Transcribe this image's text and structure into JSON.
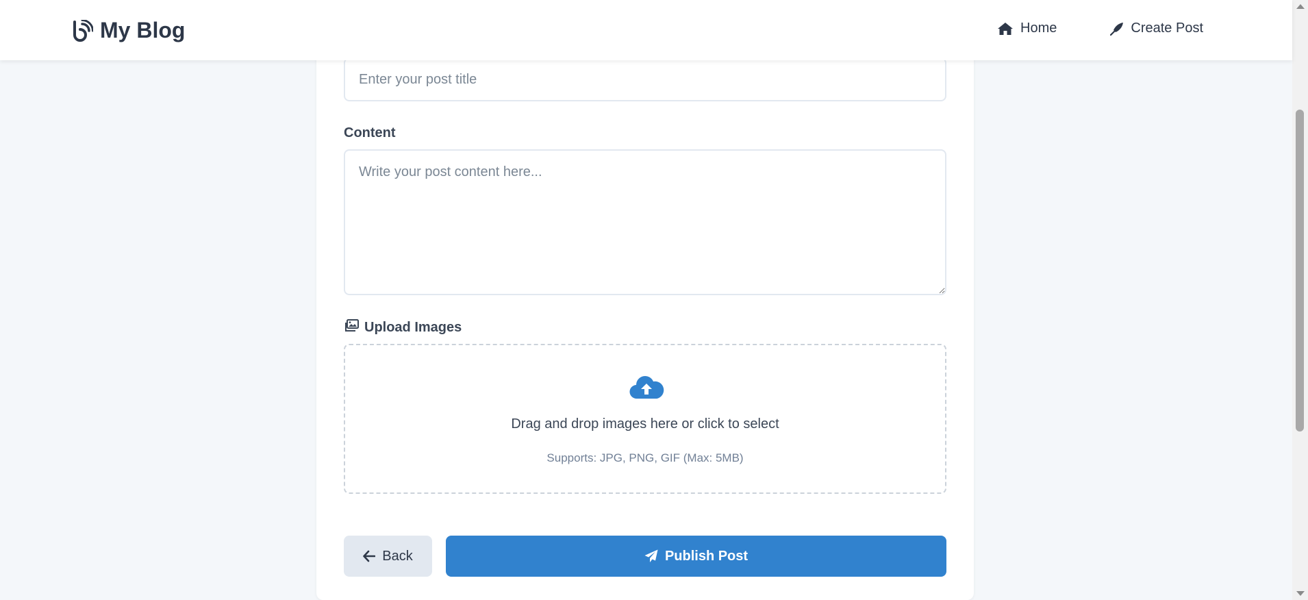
{
  "header": {
    "brand": "My Blog",
    "brand_icon": "blog-icon",
    "nav": [
      {
        "label": "Home",
        "icon": "home-icon"
      },
      {
        "label": "Create Post",
        "icon": "feather-pen-icon"
      }
    ]
  },
  "form": {
    "title_placeholder": "Enter your post title",
    "title_value": "",
    "content_label": "Content",
    "content_placeholder": "Write your post content here...",
    "content_value": "",
    "upload_label": "Upload Images",
    "upload_icon": "images-icon",
    "dropzone": {
      "icon": "cloud-upload-icon",
      "main_text": "Drag and drop images here or click to select",
      "hint": "Supports: JPG, PNG, GIF (Max: 5MB)"
    }
  },
  "actions": {
    "back_label": "Back",
    "back_icon": "arrow-left-icon",
    "publish_label": "Publish Post",
    "publish_icon": "paper-plane-icon"
  },
  "colors": {
    "accent": "#3182ce",
    "background": "#f4f7fa",
    "text": "#2d3748",
    "secondary_button": "#e2e8f0"
  }
}
